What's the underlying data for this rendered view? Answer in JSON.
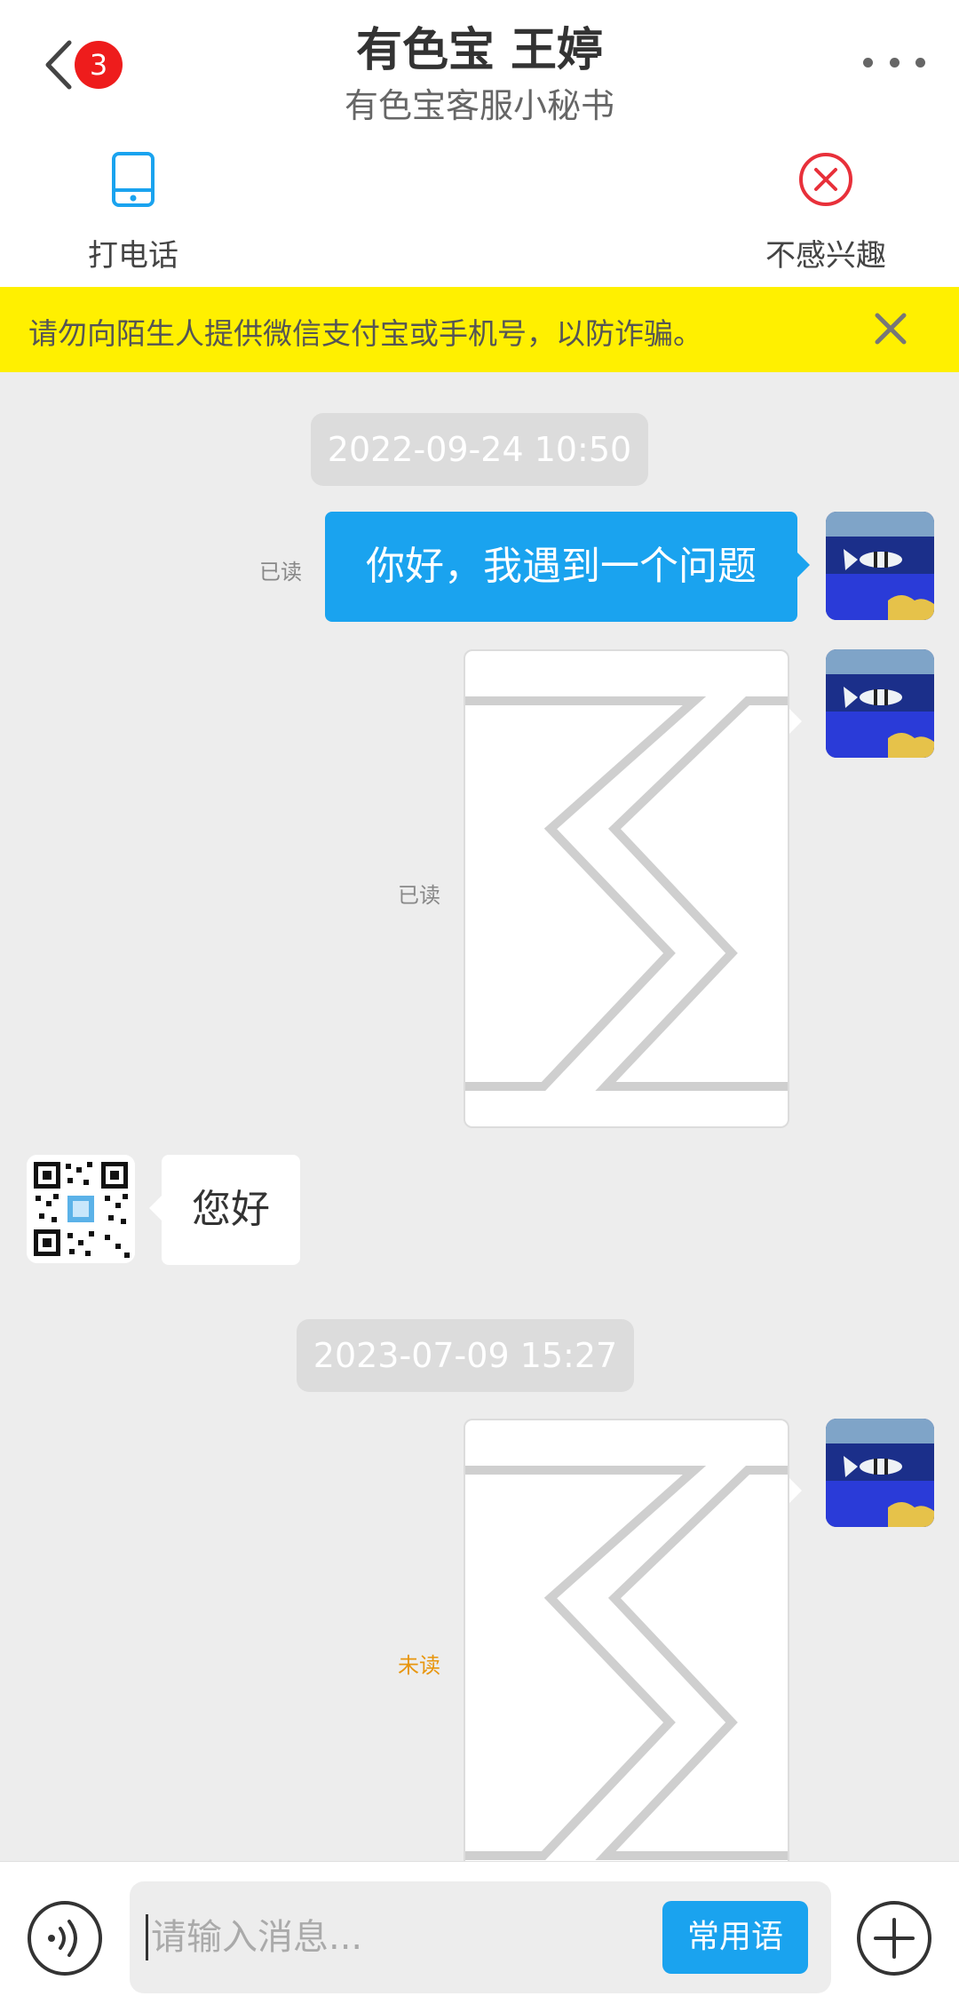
{
  "header": {
    "badge_count": "3",
    "title": "有色宝 王婷",
    "subtitle": "有色宝客服小秘书",
    "actions": [
      {
        "label": "打电话",
        "icon": "phone-icon"
      },
      {
        "label": "不感兴趣",
        "icon": "close-circle-icon"
      }
    ]
  },
  "warning": {
    "text": "请勿向陌生人提供微信支付宝或手机号，以防诈骗。"
  },
  "messages": {
    "timestamp_1": "2022-09-24 10:50",
    "msg_1_text": "你好，我遇到一个问题",
    "msg_1_status": "已读",
    "msg_2_status": "已读",
    "msg_3_text": "您好",
    "timestamp_2": "2023-07-09 15:27",
    "msg_4_status": "未读"
  },
  "input": {
    "placeholder": "请输入消息...",
    "phrases_label": "常用语"
  },
  "colors": {
    "accent": "#1aa3ef",
    "warning_bg": "#fff000",
    "badge": "#ee1c1c",
    "unread": "#e8960e"
  }
}
